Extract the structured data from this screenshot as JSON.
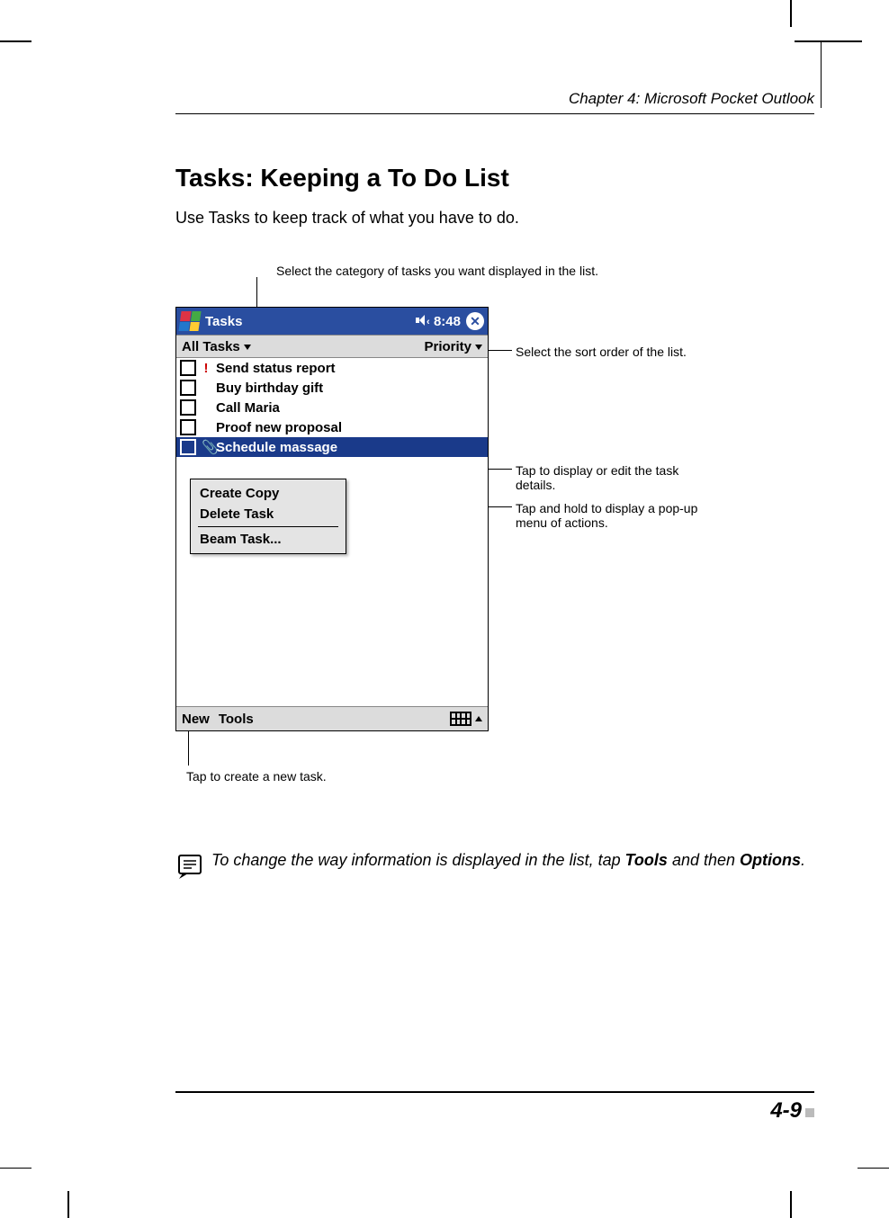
{
  "header": {
    "chapter": "Chapter 4: Microsoft Pocket Outlook"
  },
  "section": {
    "title": "Tasks: Keeping a To Do List",
    "intro": "Use Tasks to keep track of what you have to do."
  },
  "callouts": {
    "category": "Select the category of tasks you want displayed in the list.",
    "sort": "Select the sort order of the list.",
    "taskdetails": "Tap to display or edit the task details.",
    "holdmenu": "Tap and hold to display a pop-up menu of actions.",
    "newtask": "Tap to create a new task."
  },
  "device": {
    "title": "Tasks",
    "time": "8:48",
    "filter_left": "All Tasks",
    "filter_right": "Priority",
    "tasks": [
      {
        "priority": "!",
        "label": "Send status report"
      },
      {
        "priority": "",
        "label": "Buy birthday gift"
      },
      {
        "priority": "",
        "label": "Call Maria"
      },
      {
        "priority": "",
        "label": "Proof new proposal"
      },
      {
        "priority": "",
        "label": "Schedule massage",
        "selected": true,
        "attachment": true
      }
    ],
    "menu": {
      "items": [
        "Create Copy",
        "Delete Task",
        "Beam Task..."
      ]
    },
    "bottombar": {
      "new": "New",
      "tools": "Tools"
    }
  },
  "note": {
    "text_pre": "To change the way information is displayed in the list, tap ",
    "bold1": "Tools",
    "mid": " and then ",
    "bold2": "Options",
    "post": "."
  },
  "footer": {
    "page": "4-9"
  }
}
